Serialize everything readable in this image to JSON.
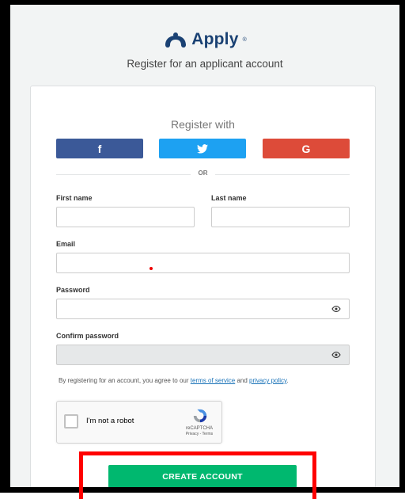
{
  "app": {
    "brand": "Apply",
    "trademark": "®",
    "subtitle": "Register for an applicant account"
  },
  "social": {
    "heading": "Register with",
    "facebook_label": "f",
    "google_label": "G",
    "divider": "OR"
  },
  "form": {
    "first_name_label": "First name",
    "last_name_label": "Last name",
    "email_label": "Email",
    "password_label": "Password",
    "confirm_password_label": "Confirm password",
    "first_name_value": "",
    "last_name_value": "",
    "email_value": "",
    "password_value": "",
    "confirm_password_value": ""
  },
  "terms": {
    "prefix": "By registering for an account, you agree to our ",
    "tos": "terms of service",
    "and": " and ",
    "privacy": "privacy policy",
    "suffix": "."
  },
  "captcha": {
    "label": "I'm not a robot",
    "brand": "reCAPTCHA",
    "links": "Privacy - Terms"
  },
  "submit": {
    "label": "CREATE ACCOUNT"
  },
  "colors": {
    "brand": "#1a4173",
    "facebook": "#3b5998",
    "twitter": "#1da1f2",
    "google": "#dd4b39",
    "submit": "#00b86f",
    "highlight": "#ff0000"
  }
}
